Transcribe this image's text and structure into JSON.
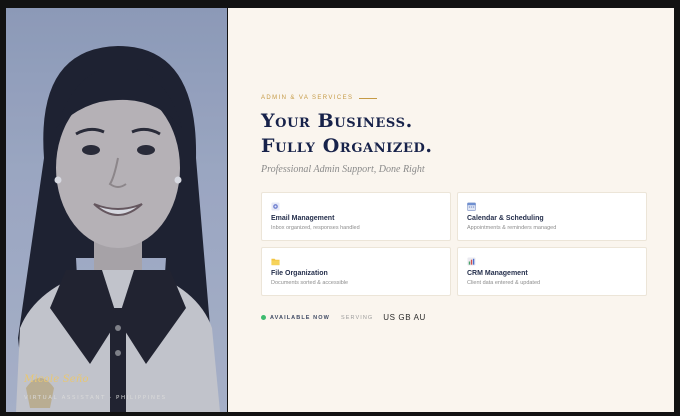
{
  "profile": {
    "signature": "Micole Seño",
    "role_line": "VIRTUAL ASSISTANT · PHILIPPINES"
  },
  "hero": {
    "eyebrow": "ADMIN & VA SERVICES",
    "headline_line1": "Your Business.",
    "headline_line2": "Fully Organized.",
    "tagline": "Professional Admin Support, Done Right"
  },
  "services": [
    {
      "title": "Email Management",
      "desc": "Inbox organized, responses handled",
      "icon": "email-icon"
    },
    {
      "title": "Calendar & Scheduling",
      "desc": "Appointments & reminders managed",
      "icon": "calendar-icon"
    },
    {
      "title": "File Organization",
      "desc": "Documents sorted & accessible",
      "icon": "folder-icon"
    },
    {
      "title": "CRM Management",
      "desc": "Client data entered & updated",
      "icon": "chart-icon"
    }
  ],
  "status": {
    "available": "AVAILABLE NOW",
    "serving_label": "SERVING",
    "countries": "US GB AU"
  },
  "colors": {
    "accent_gold": "#c59a45",
    "navy": "#17224a",
    "status_green": "#3dbb6e",
    "background": "#faf5ee"
  }
}
